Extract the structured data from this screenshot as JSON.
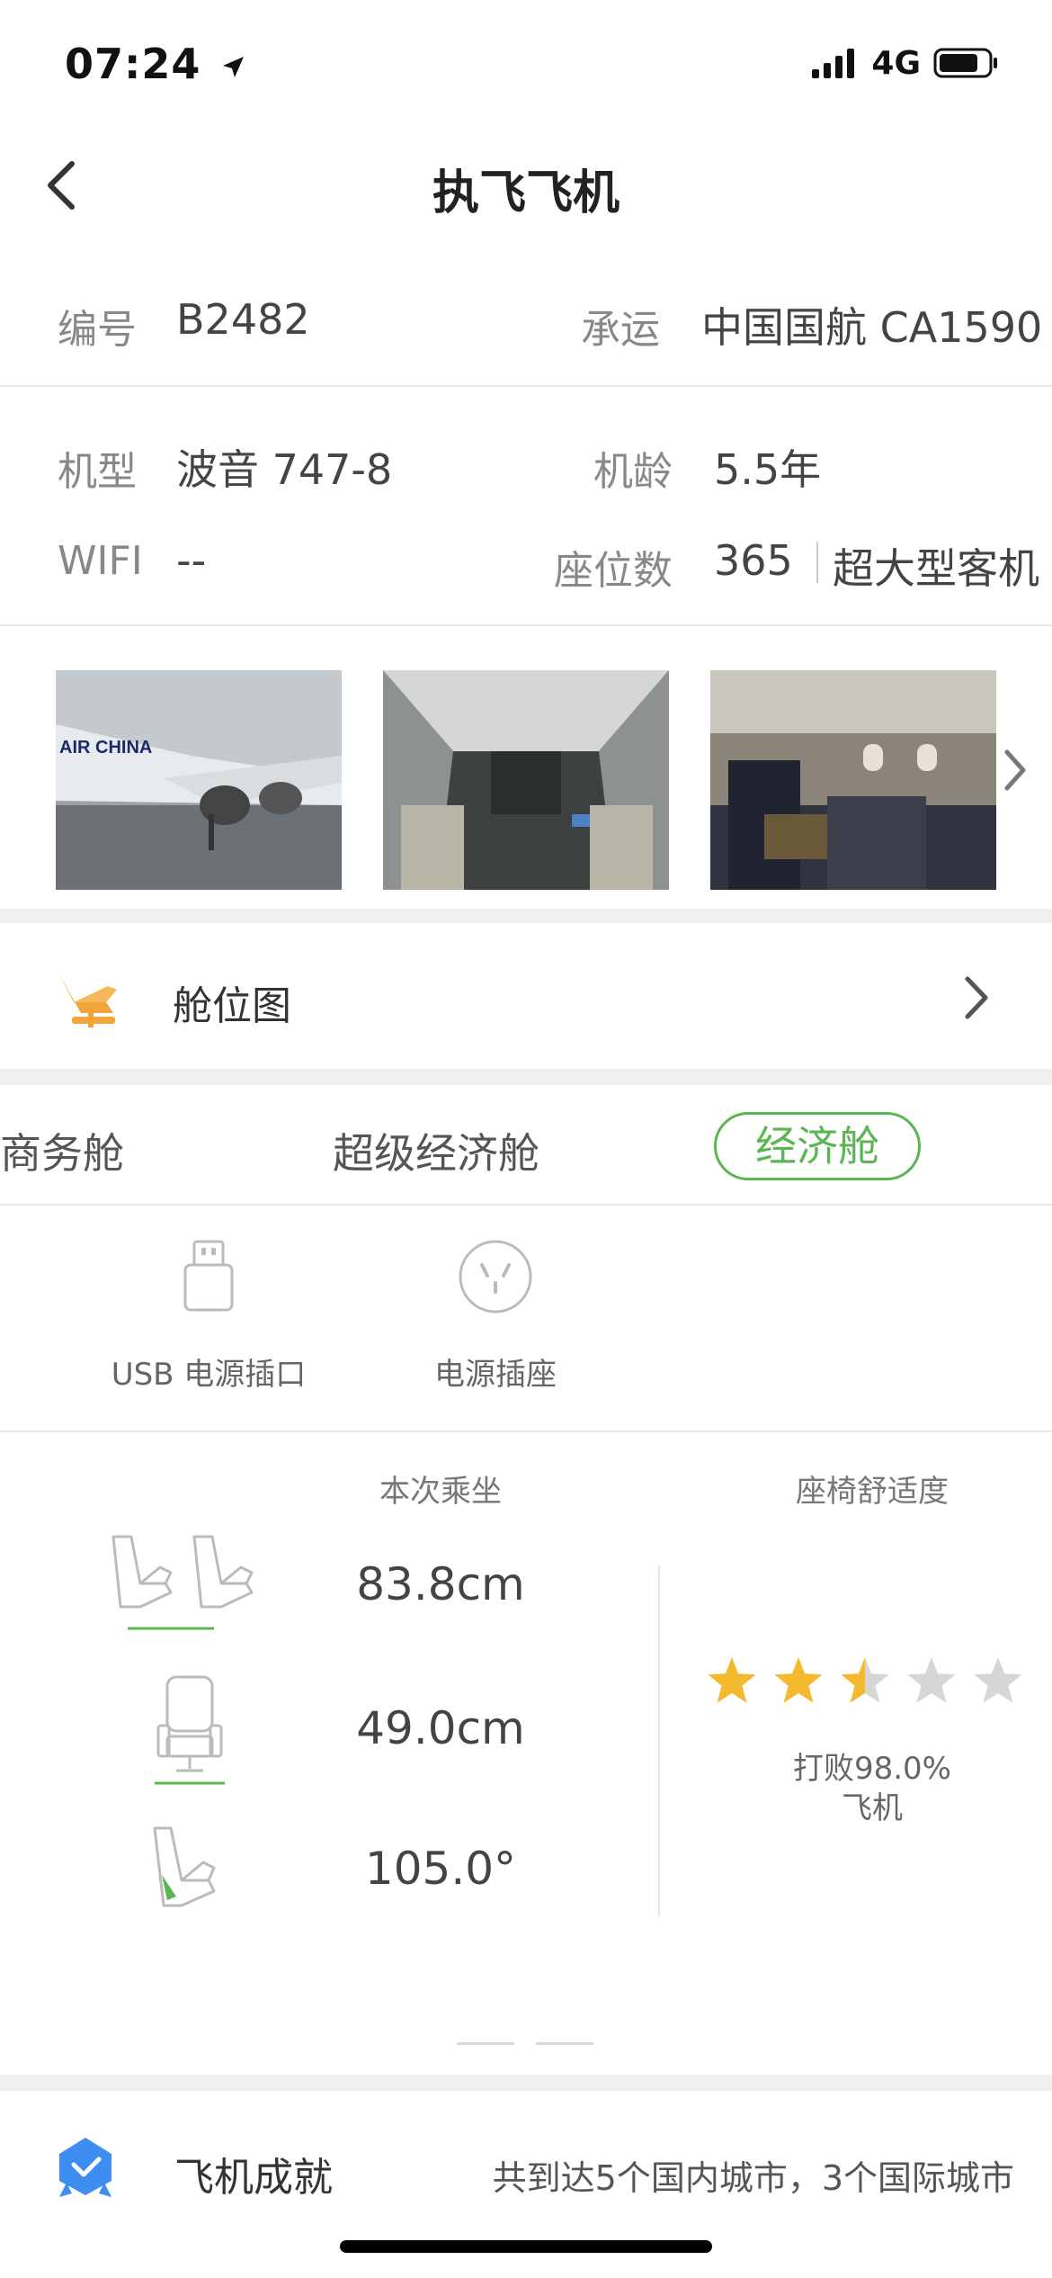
{
  "status_bar": {
    "time": "07:24",
    "network": "4G"
  },
  "nav": {
    "title": "执飞飞机"
  },
  "info": {
    "number_label": "编号",
    "number_value": "B2482",
    "carrier_label": "承运",
    "carrier_value": "中国国航 CA1590",
    "model_label": "机型",
    "model_value": "波音 747-8",
    "age_label": "机龄",
    "age_value": "5.5年",
    "wifi_label": "WIFI",
    "wifi_value": "--",
    "seats_label": "座位数",
    "seats_value": "365",
    "size_value": "超大型客机"
  },
  "photos": [
    {
      "caption": "AIR CHINA"
    },
    {
      "caption": ""
    },
    {
      "caption": ""
    }
  ],
  "seat_map": {
    "label": "舱位图"
  },
  "cabin_tabs": [
    {
      "label": "商务舱",
      "active": false
    },
    {
      "label": "超级经济舱",
      "active": false
    },
    {
      "label": "经济舱",
      "active": true
    }
  ],
  "facilities": [
    {
      "label": "USB 电源插口",
      "icon": "usb-icon"
    },
    {
      "label": "电源插座",
      "icon": "power-socket-icon"
    }
  ],
  "metrics": {
    "header_current": "本次乘坐",
    "header_comfort": "座椅舒适度",
    "seat_pitch": "83.8cm",
    "seat_width": "49.0cm",
    "recline": "105.0°",
    "rating": 2.5,
    "rating_max": 5,
    "beat_text_line1": "打败98.0%",
    "beat_text_line2": "飞机"
  },
  "achievement": {
    "label": "飞机成就",
    "text": "共到达5个国内城市，3个国际城市"
  },
  "colors": {
    "accent_green": "#5ab552",
    "star_gold": "#f4b92c",
    "seat_orange": "#f2a53a",
    "badge_blue": "#3d8ef0"
  }
}
